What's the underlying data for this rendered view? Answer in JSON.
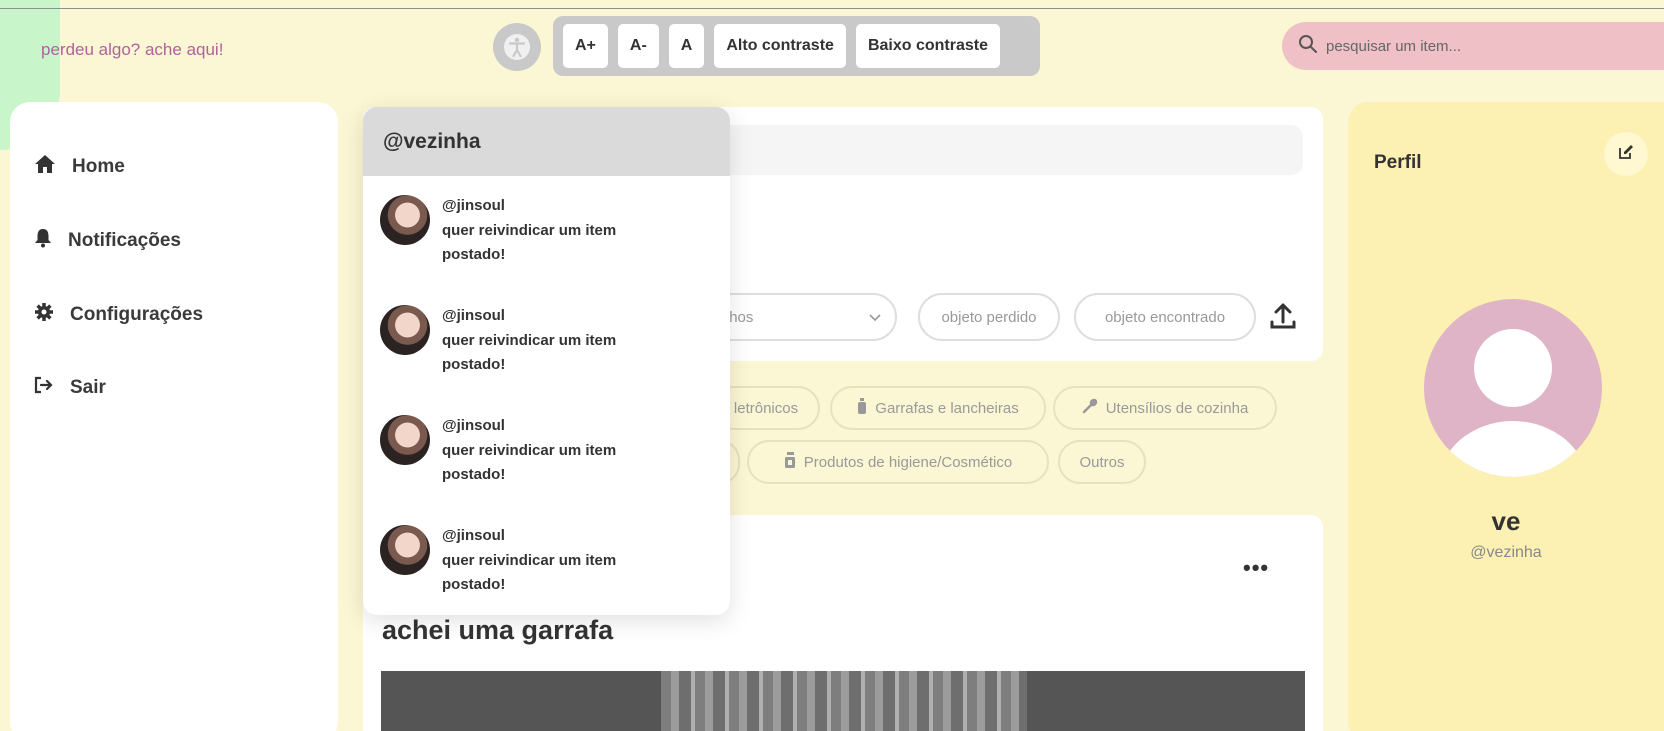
{
  "brand": "perdeu algo? ache aqui!",
  "accessibility": {
    "icon": "accessibility-icon",
    "buttons": [
      "A+",
      "A-",
      "A",
      "Alto contraste",
      "Baixo contraste"
    ]
  },
  "search": {
    "placeholder": "pesquisar um item..."
  },
  "sidebar": {
    "items": [
      {
        "label": "Home",
        "icon": "home-icon"
      },
      {
        "label": "Notificações",
        "icon": "bell-icon"
      },
      {
        "label": "Configurações",
        "icon": "gear-icon"
      },
      {
        "label": "Sair",
        "icon": "logout-icon"
      }
    ]
  },
  "composer": {
    "category_select": "agasalhos",
    "status_buttons": [
      "objeto perdido",
      "objeto encontrado"
    ]
  },
  "filters": {
    "chips": [
      "letrônicos",
      "Garrafas e lancheiras",
      "Utensílios de cozinha",
      "Produtos de higiene/Cosmético",
      "Outros"
    ]
  },
  "post": {
    "title": "achei uma garrafa",
    "more": "•••"
  },
  "notifications": {
    "header": "@vezinha",
    "items": [
      {
        "user": "@jinsoul",
        "text": "quer reivindicar um item postado!"
      },
      {
        "user": "@jinsoul",
        "text": "quer reivindicar um item postado!"
      },
      {
        "user": "@jinsoul",
        "text": "quer reivindicar um item postado!"
      },
      {
        "user": "@jinsoul",
        "text": "quer reivindicar um item postado!"
      }
    ]
  },
  "profile": {
    "title": "Perfil",
    "name": "ve",
    "handle": "@vezinha"
  },
  "colors": {
    "page_bg": "#fbf6d3",
    "brand": "#b0629b",
    "search_bg": "#efc0c5",
    "profile_bg": "#fcf1b2",
    "avatar": "#e0b4c7"
  }
}
